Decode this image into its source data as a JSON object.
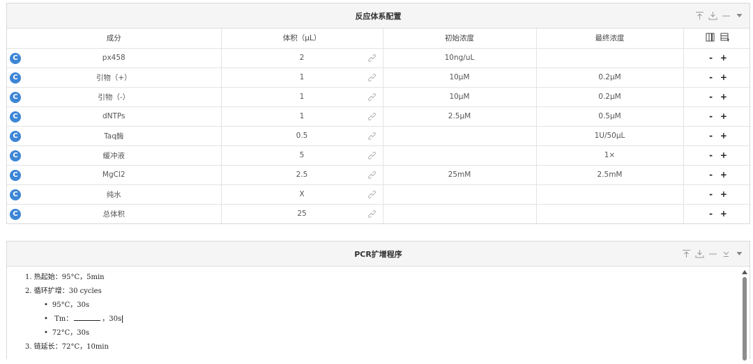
{
  "panel1": {
    "title": "反应体系配置",
    "columns": [
      "成分",
      "体积（μL）",
      "初始浓度",
      "最终浓度"
    ],
    "badge_letter": "C",
    "minus_label": "-",
    "plus_label": "+",
    "rows": [
      {
        "name": "px458",
        "volume": "2",
        "initial": "10ng/uL",
        "final": ""
      },
      {
        "name": "引物（+）",
        "volume": "1",
        "initial": "10μM",
        "final": "0.2μM"
      },
      {
        "name": "引物（-）",
        "volume": "1",
        "initial": "10μM",
        "final": "0.2μM"
      },
      {
        "name": "dNTPs",
        "volume": "1",
        "initial": "2.5μM",
        "final": "0.5μM"
      },
      {
        "name": "Taq酶",
        "volume": "0.5",
        "initial": "",
        "final": "1U/50μL"
      },
      {
        "name": "缓冲液",
        "volume": "5",
        "initial": "",
        "final": "1×"
      },
      {
        "name": "MgCl2",
        "volume": "2.5",
        "initial": "25mM",
        "final": "2.5mM"
      },
      {
        "name": "纯水",
        "volume": "X",
        "initial": "",
        "final": ""
      },
      {
        "name": "总体积",
        "volume": "25",
        "initial": "",
        "final": ""
      }
    ]
  },
  "panel2": {
    "title": "PCR扩增程序",
    "lines": [
      {
        "type": "main",
        "text": "1. 热起始：95°C，5min"
      },
      {
        "type": "main",
        "text": "2. 循环扩增：30 cycles"
      },
      {
        "type": "sub",
        "text": "95°C，30s"
      },
      {
        "type": "sub_blank",
        "prefix": "Tm：",
        "suffix": "，30s"
      },
      {
        "type": "sub",
        "text": "72°C，30s"
      },
      {
        "type": "main",
        "text": "3. 链延长：72°C，10min"
      }
    ]
  },
  "colors": {
    "badge": "#3d86d6",
    "header_bg": "#f5f5f5",
    "border": "#d9d9d9"
  },
  "icons": {
    "panel_tools": [
      "pin-top-icon",
      "download-icon",
      "minimize-icon",
      "collapse-icon"
    ],
    "table_tools": [
      "columns-icon",
      "add-row-icon"
    ],
    "row_link": "link-icon"
  }
}
